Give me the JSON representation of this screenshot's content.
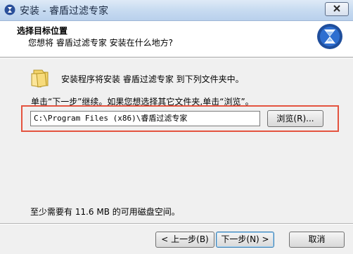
{
  "window": {
    "title": "安装 - 睿盾过滤专家"
  },
  "header": {
    "title": "选择目标位置",
    "subtitle": "您想将 睿盾过滤专家 安装在什么地方?"
  },
  "main": {
    "intro": "安装程序将安装 睿盾过滤专家 到下列文件夹中。",
    "instruction": "单击“下一步”继续。如果您想选择其它文件夹,单击“浏览”。",
    "install_path": "C:\\Program Files (x86)\\睿盾过滤专家",
    "browse_label": "浏览(R)...",
    "space_required": "至少需要有 11.6 MB 的可用磁盘空间。"
  },
  "footer": {
    "back_label": "< 上一步(B)",
    "next_label": "下一步(N) >",
    "cancel_label": "取消"
  },
  "colors": {
    "highlight": "#e4533f",
    "logo_blue": "#1f4e9c"
  },
  "icons": {
    "app": "hourglass-icon",
    "close": "close-icon",
    "folder": "folder-icon"
  }
}
